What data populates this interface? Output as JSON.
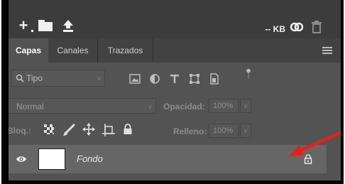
{
  "toolbar": {
    "file_size": "-- KB",
    "icons": [
      "plus-icon",
      "folder-icon",
      "upload-icon",
      "creative-cloud-icon",
      "trash-icon"
    ]
  },
  "tabs": [
    {
      "label": "Capas",
      "active": true
    },
    {
      "label": "Canales",
      "active": false
    },
    {
      "label": "Trazados",
      "active": false
    }
  ],
  "filter": {
    "search_placeholder": "Tipo",
    "icons": [
      "image-filter-icon",
      "adjustment-filter-icon",
      "type-filter-icon",
      "shape-filter-icon",
      "smart-object-filter-icon",
      "filter-toggle-icon"
    ]
  },
  "blend": {
    "mode": "Normal",
    "opacity_label": "Opacidad:",
    "opacity_value": "100%"
  },
  "lock": {
    "label": "Bloq.:",
    "icons": [
      "lock-transparent-pixels-icon",
      "lock-image-pixels-icon",
      "lock-position-icon",
      "lock-artboard-icon",
      "lock-all-icon"
    ],
    "fill_label": "Relleno:",
    "fill_value": "100%"
  },
  "layers": [
    {
      "name": "Fondo",
      "visible": true,
      "locked": true
    }
  ],
  "colors": {
    "panel": "#535353",
    "header": "#3c3c3c",
    "selected_layer": "#666666",
    "annotation_arrow": "#e8201a"
  }
}
